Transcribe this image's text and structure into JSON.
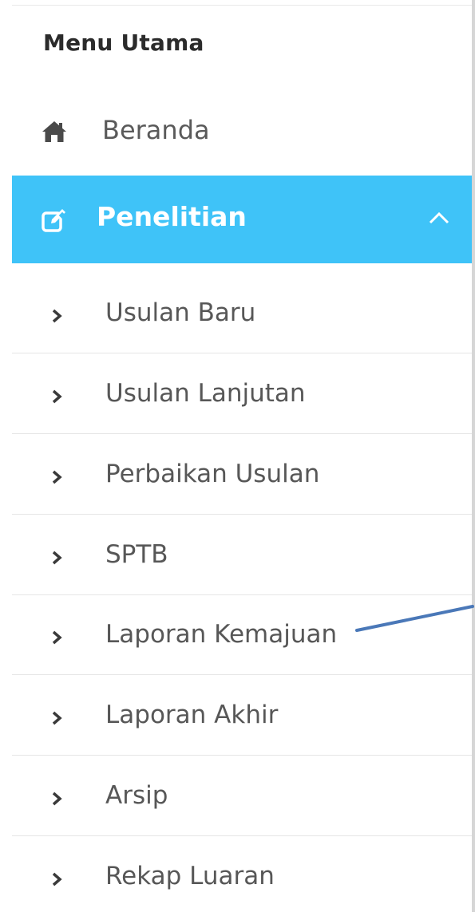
{
  "sidebar": {
    "section_title": "Menu Utama",
    "home": {
      "label": "Beranda",
      "icon": "home-icon"
    },
    "active_group": {
      "label": "Penelitian",
      "icon": "edit-icon",
      "expanded": true,
      "accent_color": "#3fc3f8"
    },
    "sub_items": [
      {
        "label": "Usulan Baru"
      },
      {
        "label": "Usulan Lanjutan"
      },
      {
        "label": "Perbaikan Usulan"
      },
      {
        "label": "SPTB"
      },
      {
        "label": "Laporan Kemajuan"
      },
      {
        "label": "Laporan Akhir"
      },
      {
        "label": "Arsip"
      },
      {
        "label": "Rekap Luaran"
      }
    ]
  }
}
